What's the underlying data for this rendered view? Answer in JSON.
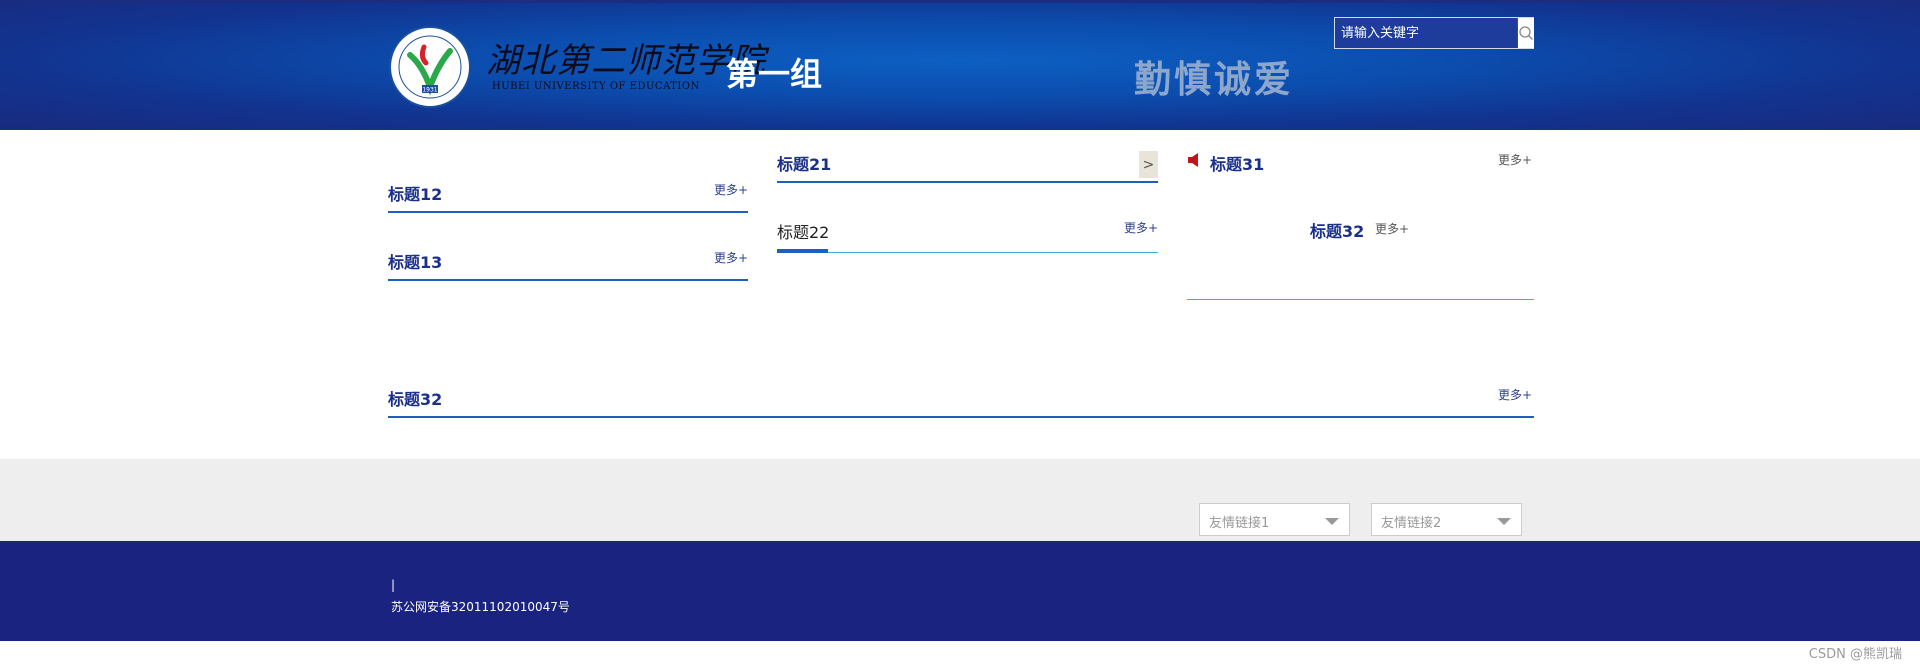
{
  "header": {
    "school_name": "湖北第二师范学院",
    "school_name_en": "HUBEI UNIVERSITY OF EDUCATION",
    "logo_year": "1931",
    "group_name": "第一组",
    "motto": "勤慎诚爱",
    "search": {
      "placeholder": "请输入关键字",
      "icon": "search-icon"
    }
  },
  "col1": {
    "sections": [
      {
        "title": "标题12",
        "more": "更多+"
      },
      {
        "title": "标题13",
        "more": "更多+"
      }
    ]
  },
  "col2": {
    "sec21": {
      "title": "标题21",
      "arrow": ">"
    },
    "sec22": {
      "title": "标题22",
      "more": "更多+"
    }
  },
  "col3": {
    "sec31": {
      "title": "标题31",
      "more": "更多+",
      "icon": "speaker-icon"
    },
    "sec32": {
      "title": "标题32",
      "more": "更多+"
    }
  },
  "wide": {
    "title": "标题32",
    "more": "更多+"
  },
  "links": [
    {
      "label": "友情链接1"
    },
    {
      "label": "友情链接2"
    }
  ],
  "footer": {
    "separator": "|",
    "record": "苏公网安备32011102010047号"
  },
  "watermark": "CSDN @熊凯瑞",
  "colors": {
    "header_blue": "#0b4eaf",
    "footer_navy": "#1a2480",
    "title_blue": "#1a2f8a",
    "accent_red": "#c0141c"
  }
}
